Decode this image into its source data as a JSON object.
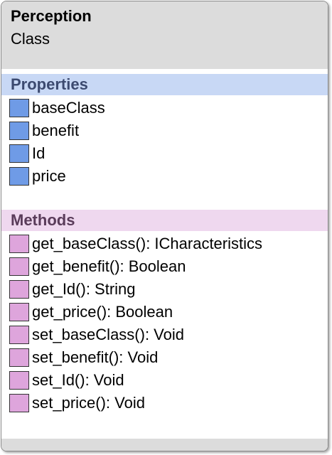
{
  "class": {
    "name": "Perception",
    "stereotype": "Class"
  },
  "properties": {
    "header": "Properties",
    "items": [
      "baseClass",
      "benefit",
      "Id",
      "price"
    ]
  },
  "methods": {
    "header": "Methods",
    "items": [
      "get_baseClass(): ICharacteristics",
      "get_benefit(): Boolean",
      "get_Id(): String",
      "get_price(): Boolean",
      "set_baseClass(): Void",
      "set_benefit(): Void",
      "set_Id(): Void",
      "set_price(): Void"
    ]
  },
  "colors": {
    "header_bg": "#dcdcdc",
    "properties_bg": "#c8d8f5",
    "methods_bg": "#efd8ef",
    "property_icon": "#6f9be6",
    "method_icon": "#dea5dc"
  },
  "icons": {
    "property": "property-icon",
    "method": "method-icon"
  }
}
